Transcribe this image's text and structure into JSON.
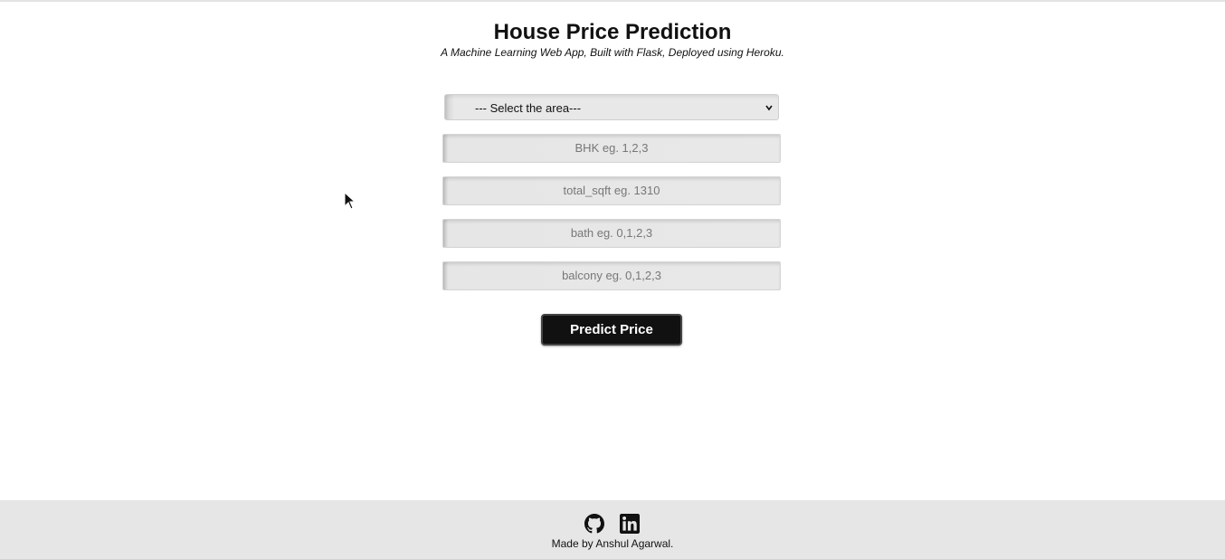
{
  "header": {
    "title": "House Price Prediction",
    "subtitle": "A Machine Learning Web App, Built with Flask, Deployed using Heroku."
  },
  "form": {
    "area_select": {
      "selected": "--- Select the area---"
    },
    "bhk": {
      "placeholder": "BHK eg. 1,2,3"
    },
    "total_sqft": {
      "placeholder": "total_sqft eg. 1310"
    },
    "bath": {
      "placeholder": "bath eg. 0,1,2,3"
    },
    "balcony": {
      "placeholder": "balcony eg. 0,1,2,3"
    },
    "submit_label": "Predict Price"
  },
  "footer": {
    "icons": [
      "github-icon",
      "linkedin-icon"
    ],
    "made_by": "Made by Anshul Agarwal."
  },
  "colors": {
    "button_bg": "#111111",
    "footer_bg": "#e6e6e6",
    "field_bg": "#e8e8e8"
  }
}
